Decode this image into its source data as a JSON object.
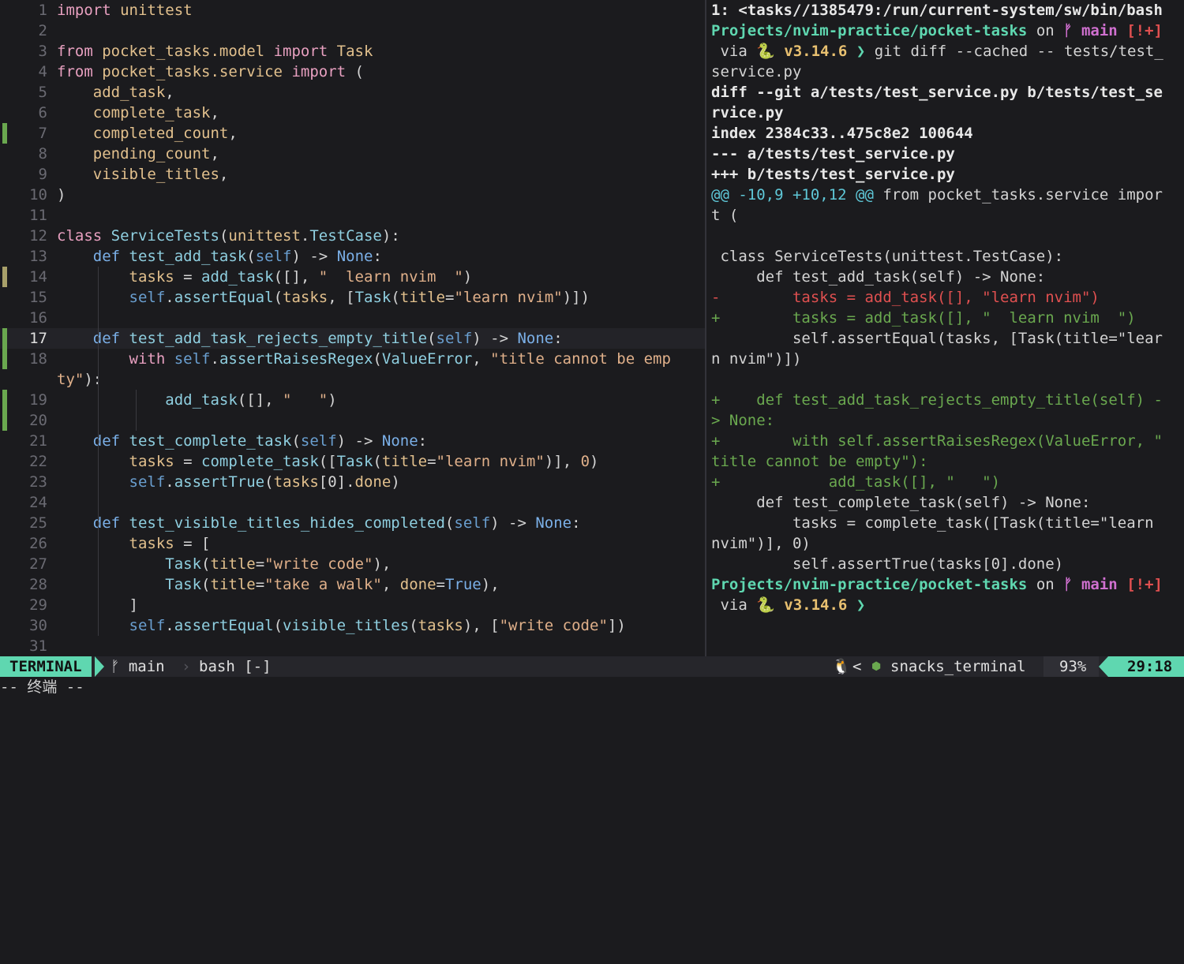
{
  "editor": {
    "lines": [
      {
        "n": "1",
        "html": "<span class='kw'>import</span> <span class='n'>unittest</span>",
        "sign": ""
      },
      {
        "n": "2",
        "html": "",
        "sign": ""
      },
      {
        "n": "3",
        "html": "<span class='kw'>from</span> <span class='n'>pocket_tasks.model</span> <span class='kw'>import</span> <span class='n'>Task</span>",
        "sign": ""
      },
      {
        "n": "4",
        "html": "<span class='kw'>from</span> <span class='n'>pocket_tasks.service</span> <span class='kw'>import</span> (",
        "sign": ""
      },
      {
        "n": "5",
        "html": "    <span class='n'>add_task</span>,",
        "sign": ""
      },
      {
        "n": "6",
        "html": "    <span class='n'>complete_task</span>,",
        "sign": ""
      },
      {
        "n": "7",
        "html": "    <span class='n'>completed_count</span>,",
        "sign": "#6aa84f"
      },
      {
        "n": "8",
        "html": "    <span class='n'>pending_count</span>,",
        "sign": ""
      },
      {
        "n": "9",
        "html": "    <span class='n'>visible_titles</span>,",
        "sign": ""
      },
      {
        "n": "10",
        "html": ")",
        "sign": ""
      },
      {
        "n": "11",
        "html": "",
        "sign": ""
      },
      {
        "n": "12",
        "html": "<span class='kw'>class</span> <span class='f'>ServiceTests</span>(<span class='n'>unittest</span>.<span class='f'>TestCase</span>):",
        "sign": ""
      },
      {
        "n": "13",
        "html": "    <span class='k'>def</span> <span class='f'>test_add_task</span>(<span class='c'>self</span>) -> <span class='k'>None</span>:",
        "sign": ""
      },
      {
        "n": "14",
        "html": "        <span class='n'>tasks</span> = <span class='f'>add_task</span>([], <span class='s'>\"  learn nvim  \"</span>)",
        "sign": "#a8a06a"
      },
      {
        "n": "15",
        "html": "        <span class='c'>self</span>.<span class='f'>assertEqual</span>(<span class='n'>tasks</span>, [<span class='f'>Task</span>(<span class='n'>title</span>=<span class='s'>\"learn nvim\"</span>)])",
        "sign": ""
      },
      {
        "n": "16",
        "html": "",
        "sign": ""
      },
      {
        "n": "17",
        "html": "    <span class='k'>def</span> <span class='f'>test_add_task_rejects_empty_title</span>(<span class='c'>self</span>) -> <span class='k'>None</span>:",
        "sign": "#6aa84f",
        "cur": true
      },
      {
        "n": "18",
        "html": "        <span class='kw'>with</span> <span class='c'>self</span>.<span class='f'>assertRaisesRegex</span>(<span class='f'>ValueError</span>, <span class='s'>\"title cannot be emp</span>",
        "sign": "#6aa84f"
      },
      {
        "n": "",
        "html": "<span class='s'>ty\"</span>):",
        "sign": "",
        "wrap": true
      },
      {
        "n": "19",
        "html": "            <span class='f'>add_task</span>([], <span class='s'>\"   \"</span>)",
        "sign": "#6aa84f"
      },
      {
        "n": "20",
        "html": "",
        "sign": "#6aa84f"
      },
      {
        "n": "21",
        "html": "    <span class='k'>def</span> <span class='f'>test_complete_task</span>(<span class='c'>self</span>) -> <span class='k'>None</span>:",
        "sign": ""
      },
      {
        "n": "22",
        "html": "        <span class='n'>tasks</span> = <span class='f'>complete_task</span>([<span class='f'>Task</span>(<span class='n'>title</span>=<span class='s'>\"learn nvim\"</span>)], <span class='s'>0</span>)",
        "sign": ""
      },
      {
        "n": "23",
        "html": "        <span class='c'>self</span>.<span class='f'>assertTrue</span>(<span class='n'>tasks</span>[0].<span class='n'>done</span>)",
        "sign": ""
      },
      {
        "n": "24",
        "html": "",
        "sign": ""
      },
      {
        "n": "25",
        "html": "    <span class='k'>def</span> <span class='f'>test_visible_titles_hides_completed</span>(<span class='c'>self</span>) -> <span class='k'>None</span>:",
        "sign": ""
      },
      {
        "n": "26",
        "html": "        <span class='n'>tasks</span> = [",
        "sign": ""
      },
      {
        "n": "27",
        "html": "            <span class='f'>Task</span>(<span class='n'>title</span>=<span class='s'>\"write code\"</span>),",
        "sign": ""
      },
      {
        "n": "28",
        "html": "            <span class='f'>Task</span>(<span class='n'>title</span>=<span class='s'>\"take a walk\"</span>, <span class='n'>done</span>=<span class='k'>True</span>),",
        "sign": ""
      },
      {
        "n": "29",
        "html": "        ]",
        "sign": ""
      },
      {
        "n": "30",
        "html": "        <span class='c'>self</span>.<span class='f'>assertEqual</span>(<span class='f'>visible_titles</span>(<span class='n'>tasks</span>), [<span class='s'>\"write code\"</span>])",
        "sign": ""
      },
      {
        "n": "31",
        "html": "",
        "sign": ""
      }
    ]
  },
  "terminal": {
    "lines": [
      {
        "html": "<b>1: &lt;tasks//1385479:/run/current-system/sw/bin/bash</b>",
        "color": "#e8e8e8"
      },
      {
        "html": "<b style='color:#5fd7b0'>Projects/nvim-practice/pocket-tasks</b> on <b style='color:#d070d0'>ᚠ main</b> <b style='color:#e05050'>[!+]</b>",
        "color": "#d4d4d4"
      },
      {
        "html": " via 🐍 <b style='color:#e8c070'>v3.14.6</b> <b style='color:#5fd7b0'>❯</b> git diff --cached -- tests/test_",
        "color": "#d4d4d4"
      },
      {
        "html": "service.py",
        "color": "#d4d4d4"
      },
      {
        "html": "<b>diff --git a/tests/test_service.py b/tests/test_se</b>",
        "color": "#e8e8e8"
      },
      {
        "html": "<b>rvice.py</b>",
        "color": "#e8e8e8"
      },
      {
        "html": "<b>index 2384c33..475c8e2 100644</b>",
        "color": "#e8e8e8"
      },
      {
        "html": "<b>--- a/tests/test_service.py</b>",
        "color": "#e8e8e8"
      },
      {
        "html": "<b>+++ b/tests/test_service.py</b>",
        "color": "#e8e8e8"
      },
      {
        "html": "<span style='color:#5fc8d8'>@@ -10,9 +10,12 @@</span> from pocket_tasks.service impor",
        "color": "#d4d4d4"
      },
      {
        "html": "t (",
        "color": "#d4d4d4"
      },
      {
        "html": "",
        "color": "#d4d4d4"
      },
      {
        "html": " class ServiceTests(unittest.TestCase):",
        "color": "#d4d4d4"
      },
      {
        "html": "     def test_add_task(self) -> None:",
        "color": "#d4d4d4"
      },
      {
        "html": "-        tasks = add_task([], \"learn nvim\")",
        "color": "#e05050"
      },
      {
        "html": "+        tasks = add_task([], \"  learn nvim  \")",
        "color": "#6aa84f"
      },
      {
        "html": "         self.assertEqual(tasks, [Task(title=\"lear",
        "color": "#d4d4d4"
      },
      {
        "html": "n nvim\")])",
        "color": "#d4d4d4"
      },
      {
        "html": "",
        "color": "#d4d4d4"
      },
      {
        "html": "+    def test_add_task_rejects_empty_title(self) -",
        "color": "#6aa84f"
      },
      {
        "html": "> None:",
        "color": "#6aa84f"
      },
      {
        "html": "+        with self.assertRaisesRegex(ValueError, \"",
        "color": "#6aa84f"
      },
      {
        "html": "title cannot be empty\"):",
        "color": "#6aa84f"
      },
      {
        "html": "+            add_task([], \"   \")",
        "color": "#6aa84f"
      },
      {
        "html": "     def test_complete_task(self) -> None:",
        "color": "#d4d4d4"
      },
      {
        "html": "         tasks = complete_task([Task(title=\"learn",
        "color": "#d4d4d4"
      },
      {
        "html": "nvim\")], 0)",
        "color": "#d4d4d4"
      },
      {
        "html": "         self.assertTrue(tasks[0].done)",
        "color": "#d4d4d4"
      },
      {
        "html": "<b style='color:#5fd7b0'>Projects/nvim-practice/pocket-tasks</b> on <b style='color:#d070d0'>ᚠ main</b> <b style='color:#e05050'>[!+]</b>",
        "color": "#d4d4d4"
      },
      {
        "html": " via 🐍 <b style='color:#e8c070'>v3.14.6</b> <b style='color:#5fd7b0'>❯</b>",
        "color": "#d4d4d4"
      }
    ]
  },
  "statusbar": {
    "mode": "TERMINAL",
    "branch": "ᚠ main",
    "buffer": "bash [-]",
    "os_icon": "linux-icon",
    "filetype": "snacks_terminal",
    "percent": "93%",
    "position": "29:18"
  },
  "cmdline": {
    "text": "-- 终端 --"
  },
  "colors": {
    "accent": "#5fd7b0",
    "added": "#6aa84f",
    "removed": "#e05050",
    "changed": "#a8a06a"
  }
}
